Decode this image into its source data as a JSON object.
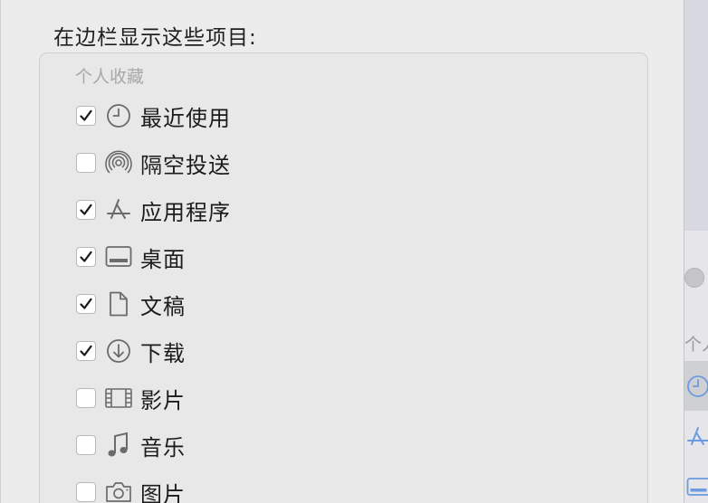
{
  "dialog": {
    "section_title": "在边栏显示这些项目:",
    "group_header": "个人收藏",
    "items": [
      {
        "label": "最近使用",
        "icon": "clock-icon",
        "checked": true
      },
      {
        "label": "隔空投送",
        "icon": "airdrop-icon",
        "checked": false
      },
      {
        "label": "应用程序",
        "icon": "applications-icon",
        "checked": true
      },
      {
        "label": "桌面",
        "icon": "desktop-icon",
        "checked": true
      },
      {
        "label": "文稿",
        "icon": "document-icon",
        "checked": true
      },
      {
        "label": "下载",
        "icon": "download-icon",
        "checked": true
      },
      {
        "label": "影片",
        "icon": "film-icon",
        "checked": false
      },
      {
        "label": "音乐",
        "icon": "music-icon",
        "checked": false
      },
      {
        "label": "图片",
        "icon": "camera-icon",
        "checked": false
      }
    ]
  },
  "background_window": {
    "sidebar_header": "个人",
    "icons": [
      "clock-icon",
      "applications-icon",
      "desktop-icon"
    ]
  },
  "colors": {
    "panel_bg": "#ececec",
    "text": "#1c1c1c",
    "header_gray": "#a8a8a8",
    "icon_gray": "#6b6b6b",
    "bg_accent_blue": "#6b9be0"
  }
}
